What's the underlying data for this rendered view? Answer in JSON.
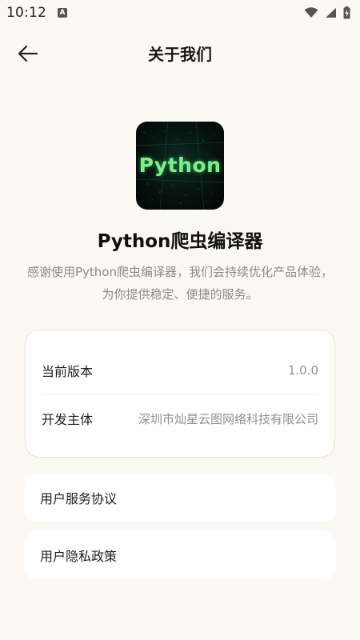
{
  "status_bar": {
    "time": "10:12",
    "notification_badge": "A",
    "icons": [
      "wifi-icon",
      "signal-icon",
      "battery-charging-icon"
    ]
  },
  "header": {
    "title": "关于我们",
    "back_icon": "arrow-left-icon"
  },
  "app": {
    "logo_text": "Python",
    "name": "Python爬虫编译器",
    "description": "感谢使用Python爬虫编译器，我们会持续优化产品体验，为你提供稳定、便捷的服务。"
  },
  "info": {
    "version_label": "当前版本",
    "version_value": "1.0.0",
    "developer_label": "开发主体",
    "developer_value": "深圳市灿星云图网络科技有限公司"
  },
  "links": {
    "user_agreement": "用户服务协议",
    "privacy_policy": "用户隐私政策"
  },
  "colors": {
    "background": "#fcf9f4",
    "card": "#ffffff",
    "card_border": "#eee3cf",
    "secondary_text": "#8a8a8a",
    "logo_green": "#7df08a"
  }
}
